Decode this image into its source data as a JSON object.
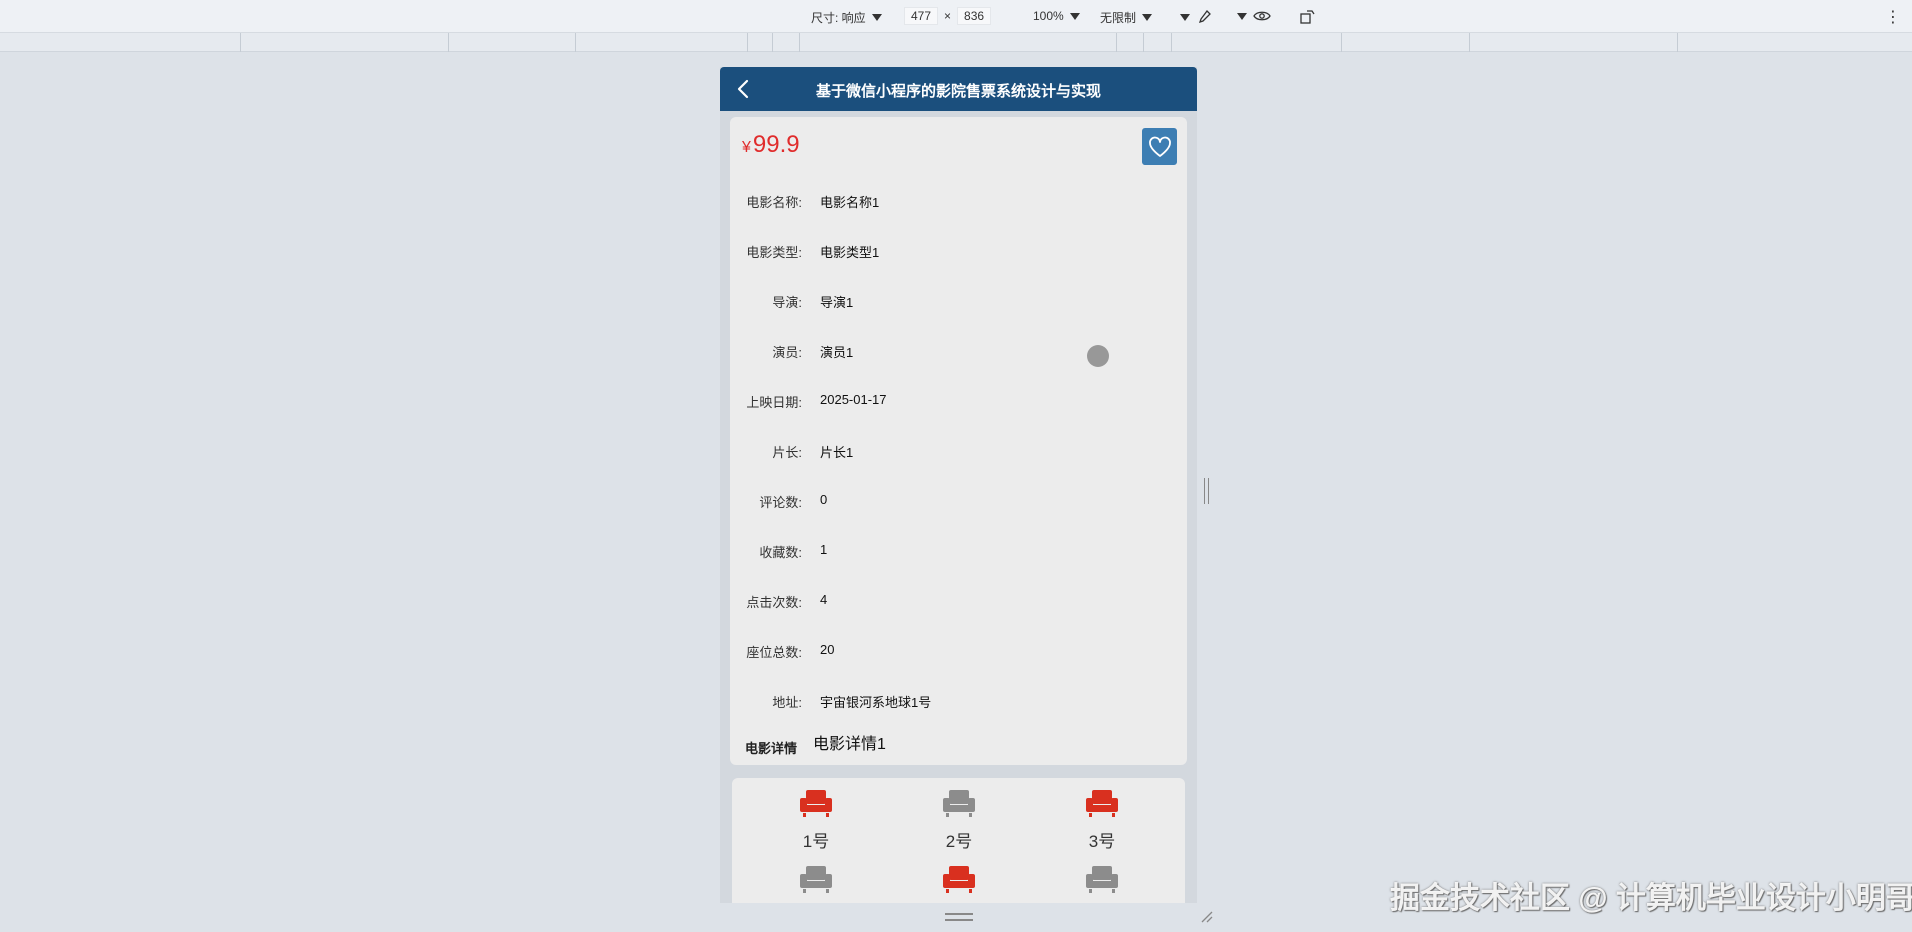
{
  "devtools": {
    "size_label": "尺寸: 响应",
    "width": "477",
    "times": "×",
    "height": "836",
    "zoom": "100%",
    "throttle": "无限制"
  },
  "app": {
    "title": "基于微信小程序的影院售票系统设计与实现",
    "price_currency": "¥",
    "price": "99.9",
    "fields": [
      {
        "label": "电影名称:",
        "value": "电影名称1"
      },
      {
        "label": "电影类型:",
        "value": "电影类型1"
      },
      {
        "label": "导演:",
        "value": "导演1"
      },
      {
        "label": "演员:",
        "value": "演员1"
      },
      {
        "label": "上映日期:",
        "value": "2025-01-17"
      },
      {
        "label": "片长:",
        "value": "片长1"
      },
      {
        "label": "评论数:",
        "value": "0"
      },
      {
        "label": "收藏数:",
        "value": "1"
      },
      {
        "label": "点击次数:",
        "value": "4"
      },
      {
        "label": "座位总数:",
        "value": "20"
      },
      {
        "label": "地址:",
        "value": "宇宙银河系地球1号"
      }
    ],
    "detail_label": "电影详情",
    "detail_value": "电影详情1",
    "seats": [
      {
        "label": "1号",
        "status": "taken",
        "color": "#d9301f"
      },
      {
        "label": "2号",
        "status": "free",
        "color": "#8c8c8c"
      },
      {
        "label": "3号",
        "status": "taken",
        "color": "#d9301f"
      },
      {
        "label": "",
        "status": "free",
        "color": "#8c8c8c"
      },
      {
        "label": "",
        "status": "taken",
        "color": "#d9301f"
      },
      {
        "label": "",
        "status": "free",
        "color": "#8c8c8c"
      }
    ]
  },
  "watermark": "掘金技术社区 @ 计算机毕业设计小明哥",
  "colors": {
    "nav": "#1b4f7d",
    "price": "#e02c2c",
    "fav": "#3d7eb3"
  }
}
